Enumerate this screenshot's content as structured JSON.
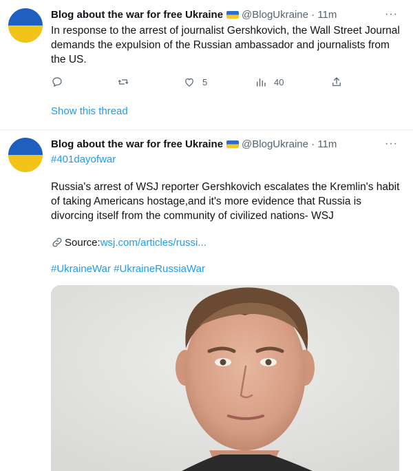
{
  "tweets": [
    {
      "author": "Blog about the war for free Ukraine",
      "handle": "@BlogUkraine",
      "dot": "·",
      "time": "11m",
      "more": "···",
      "text": "In response to the arrest of journalist Gershkovich, the Wall Street Journal demands the expulsion of the Russian ambassador and journalists from the US.",
      "likes": "5",
      "views": "40",
      "show_thread": "Show this thread"
    },
    {
      "author": "Blog about the war for free Ukraine",
      "handle": "@BlogUkraine",
      "dot": "·",
      "time": "11m",
      "more": "···",
      "top_hashtag": "#401dayofwar",
      "text": "Russia's arrest of WSJ reporter Gershkovich escalates the Kremlin's habit of taking Americans hostage,and it's more evidence that Russia is divorcing itself from the community of civilized nations- WSJ",
      "source_label": "Source:",
      "source_url": "wsj.com/articles/russi...",
      "hashtag_1": "#UkraineWar",
      "hashtag_2": "#UkraineRussiaWar"
    }
  ],
  "colors": {
    "accent": "#1d9bf0",
    "muted": "#536471",
    "flag_blue": "#1f5fbf",
    "flag_yellow": "#f2c318"
  },
  "icons": [
    "reply-icon",
    "retweet-icon",
    "like-icon",
    "views-icon",
    "share-icon",
    "link-icon",
    "more-icon",
    "ukraine-flag-icon"
  ]
}
